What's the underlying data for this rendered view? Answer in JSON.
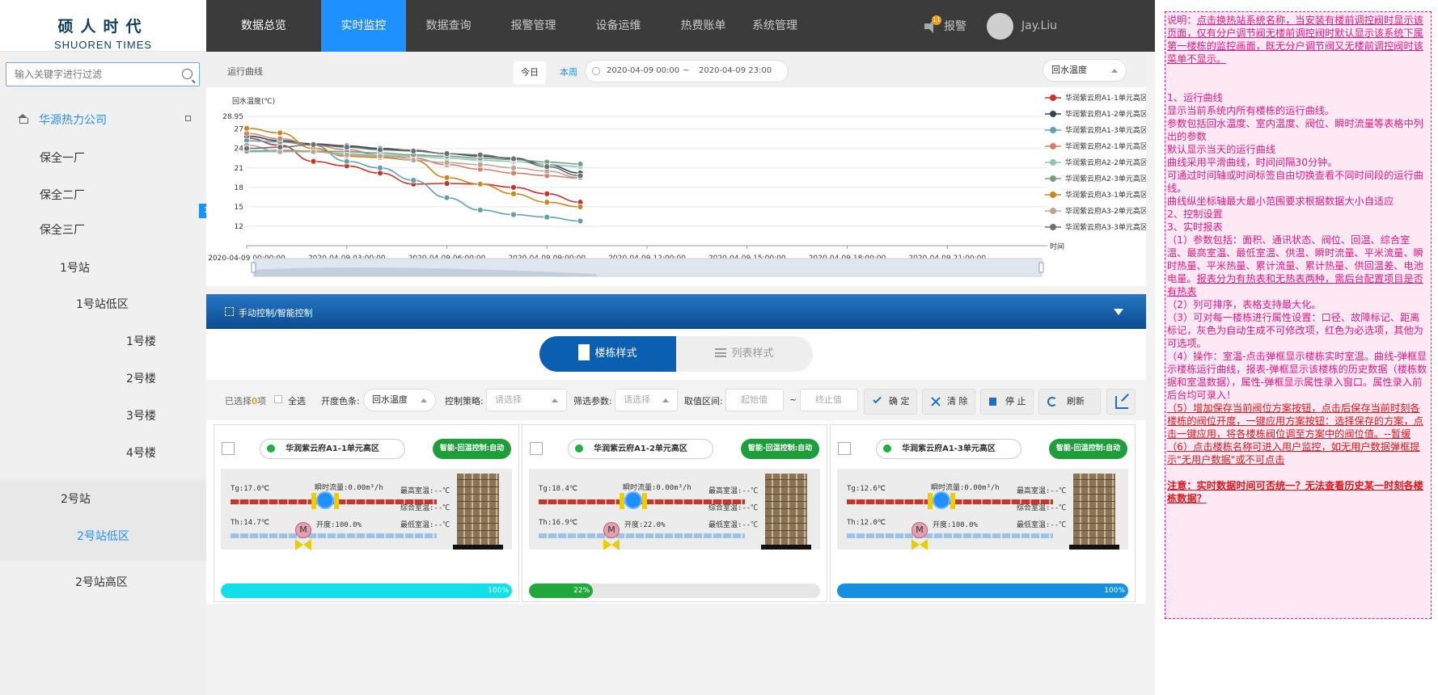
{
  "logo": {
    "cn": "硕人时代",
    "en": "SHUOREN TIMES"
  },
  "nav": {
    "items": [
      "数据总览",
      "实时监控",
      "数据查询",
      "报警管理",
      "设备运维",
      "热费账单",
      "系统管理"
    ],
    "active": "实时监控"
  },
  "header": {
    "alarm_label": "报警",
    "alarm_count": "11",
    "user_name": "Jay.Liu"
  },
  "sidebar": {
    "search_placeholder": "输入关键字进行过滤",
    "tree": {
      "company": "华源热力公司",
      "plants": [
        "保全一厂",
        "保全二厂",
        "保全三厂"
      ],
      "station1": "1号站",
      "station1_low": "1号站低区",
      "buildings": [
        "1号楼",
        "2号楼",
        "3号楼",
        "4号楼"
      ],
      "station2": "2号站",
      "station2_low": "2号站低区",
      "station2_high": "2号站高区"
    },
    "page_badge": "1"
  },
  "chart_toolbar": {
    "title": "运行曲线",
    "today": "今日",
    "week": "本周",
    "start": "2020-04-09 00:00",
    "separator": "~",
    "end": "2020-04-09 23:00",
    "metric": "回水温度"
  },
  "chart_data": {
    "type": "line",
    "ylabel": "回水温度(℃)",
    "xlabel": "时间",
    "y_ticks": [
      "28.95",
      "27",
      "24",
      "21",
      "18",
      "15",
      "12"
    ],
    "x_ticks": [
      "2020-04-09 00:00:00",
      "2020-04-09 03:00:00",
      "2020-04-09 06:00:00",
      "2020-04-09 09:00:00",
      "2020-04-09 12:00:00",
      "2020-04-09 15:00:00",
      "2020-04-09 18:00:00",
      "2020-04-09 21:00:00"
    ],
    "ylim": [
      9,
      28.95
    ],
    "x_hours": [
      0,
      1,
      2,
      3,
      4,
      5,
      6,
      7,
      8,
      9,
      10
    ],
    "legend_position": "right",
    "series": [
      {
        "name": "华润紫云府A1-1单元高区",
        "color": "#c23531",
        "values": [
          25.6,
          24.5,
          22.0,
          21.3,
          20.2,
          18.5,
          18.6,
          18.5,
          18.0,
          17.0,
          15.7
        ]
      },
      {
        "name": "华润紫云府A1-2单元高区",
        "color": "#2f4554",
        "values": [
          25.9,
          25.2,
          24.7,
          24.4,
          24.0,
          23.7,
          23.2,
          22.8,
          22.5,
          21.5,
          20.2
        ]
      },
      {
        "name": "华润紫云府A1-3单元高区",
        "color": "#61a0a8",
        "values": [
          25.2,
          25.0,
          24.5,
          22.0,
          21.0,
          19.1,
          16.4,
          14.5,
          13.8,
          13.4,
          12.8
        ]
      },
      {
        "name": "华润紫云府A2-1单元高区",
        "color": "#d48265",
        "values": [
          26.3,
          25.5,
          24.5,
          23.8,
          23.0,
          22.5,
          21.5,
          20.8,
          20.2,
          19.8,
          19.4
        ]
      },
      {
        "name": "华润紫云府A2-2单元高区",
        "color": "#91c7ae",
        "values": [
          23.5,
          23.5,
          23.5,
          23.2,
          23.0,
          22.8,
          22.5,
          22.2,
          22.0,
          21.5,
          21.2
        ]
      },
      {
        "name": "华润紫云府A2-3单元高区",
        "color": "#749f83",
        "values": [
          23.6,
          23.7,
          23.6,
          23.5,
          23.3,
          23.0,
          22.8,
          22.5,
          22.3,
          21.9,
          21.6
        ]
      },
      {
        "name": "华润紫云府A3-1单元高区",
        "color": "#ca8622",
        "values": [
          27.1,
          26.4,
          24.0,
          22.8,
          22.6,
          22.2,
          19.5,
          18.5,
          17.0,
          15.7,
          15.0
        ]
      },
      {
        "name": "华润紫云府A3-2单元高区",
        "color": "#bda29a",
        "values": [
          24.5,
          23.5,
          23.5,
          23.0,
          22.8,
          22.2,
          21.8,
          21.5,
          21.0,
          20.5,
          19.5
        ]
      },
      {
        "name": "华润紫云府A3-3单元高区",
        "color": "#6e7074",
        "values": [
          24.0,
          24.2,
          24.6,
          24.2,
          23.8,
          23.6,
          23.2,
          23.0,
          22.4,
          21.2,
          19.8
        ]
      }
    ]
  },
  "control_bar": {
    "label": "手动控制/智能控制"
  },
  "view_toggle": {
    "building_style": "楼栋样式",
    "list_style": "列表样式"
  },
  "filters": {
    "selected_prefix": "已选择",
    "selected_count": "0",
    "selected_suffix": "项",
    "select_all": "全选",
    "color_label": "开度色条:",
    "color_value": "回水温度",
    "strategy_label": "控制策略:",
    "strategy_placeholder": "请选择",
    "param_label": "筛选参数:",
    "param_placeholder": "请选择",
    "range_label": "取值区间:",
    "range_min_placeholder": "起始值",
    "range_sep": "~",
    "range_max_placeholder": "终止值",
    "confirm": "确 定",
    "clear": "清 除",
    "stop": "停 止",
    "refresh": "刷新"
  },
  "cards": [
    {
      "name": "华润紫云府A1-1单元高区",
      "status": "智能-回温控制:自动",
      "tg": "Tg:17.0℃",
      "th": "Th:14.7℃",
      "flow": "瞬时流量:0.00m³/h",
      "max_room": "最高室温:--℃",
      "avg_room": "综合室温:--℃",
      "min_room": "最低室温:--℃",
      "opening": "开度:100.0%",
      "progress_label": "100%",
      "progress": 1.0,
      "bar_color": "#12e0e8"
    },
    {
      "name": "华润紫云府A1-2单元高区",
      "status": "智能-回温控制:自动",
      "tg": "Tg:18.4℃",
      "th": "Th:16.9℃",
      "flow": "瞬时流量:0.00m³/h",
      "max_room": "最高室温:--℃",
      "avg_room": "综合室温:--℃",
      "min_room": "最低室温:--℃",
      "opening": "开度:22.0%",
      "progress_label": "22%",
      "progress": 0.22,
      "bar_color": "#20a83a"
    },
    {
      "name": "华润紫云府A1-3单元高区",
      "status": "智能-回温控制:自动",
      "tg": "Tg:12.6℃",
      "th": "Th:12.0℃",
      "flow": "瞬时流量:0.00m³/h",
      "max_room": "最高室温:--℃",
      "avg_room": "综合室温:--℃",
      "min_room": "最低室温:--℃",
      "opening": "开度:100.0%",
      "progress_label": "100%",
      "progress": 1.0,
      "bar_color": "#1590e0"
    }
  ],
  "notes": {
    "intro_prefix": "说明：",
    "intro_body": "点击换热站系统名称，当安装有楼前调控阀时显示该页面，仅有分户调节阀无楼前调控阀时默认显示该系统下属第一楼栋的监控画面，既无分户调节阀又无楼前调控阀时该菜单不显示。",
    "s1_title": "1、运行曲线",
    "s1_l1": "显示当前系统内所有楼栋的运行曲线。",
    "s1_l2": "参数包括回水温度、室内温度、阀位、瞬时流量等表格中列出的参数",
    "s1_l3": "默认显示当天的运行曲线",
    "s1_l4": "曲线采用平滑曲线，时间间隔30分钟。",
    "s1_l5": "可通过时间轴或时间标签自由切换查看不同时间段的运行曲线。",
    "s1_l6": "曲线纵坐标轴最大最小范围要求根据数据大小自适应",
    "s2_title": "2、控制设置",
    "s3_title": "3、实时报表",
    "s3_p1": "（1）参数包括：面积、通讯状态、阀位、回温、综合室温、最高室温、最低室温、供温、瞬时流量、平米流量、瞬时热量、平米热量、累计流量、累计热量、供回温差、电池电量。",
    "s3_p1_u": "报表分为有热表和无热表两种，需后台配置项目是否有热表",
    "s3_p2": "（2）列可排序，表格支持最大化。",
    "s3_p3": "（3）可对每一楼栋进行属性设置：口径、故障标记、距离标记，灰色为自动生成不可修改项，红色为必选项，其他为可选项。",
    "s3_p4": "（4）操作：室温-点击弹框显示楼栋实时室温。曲线-弹框显示楼栋运行曲线，报表-弹框显示该楼栋的历史数据（楼栋数据和室温数据），属性-弹框显示属性录入窗口。属性录入前后台均可录入！",
    "s3_p5": "（5）增加保存当前阀位方案按钮，点击后保存当前时刻各楼栋的阀位开度，一键应用方案按钮：选择保存的方案，点击一键应用，将各楼栋阀位调至方案中的阀位值。--暂缓",
    "s3_p6": "（6）点击楼栋名称可进入用户监控，如无用户数据弹框提示\"无用户数据\"或不可点击",
    "attention": "注意：实时数据时间可否统一？无法查看历史某一时刻各楼栋数据？"
  }
}
